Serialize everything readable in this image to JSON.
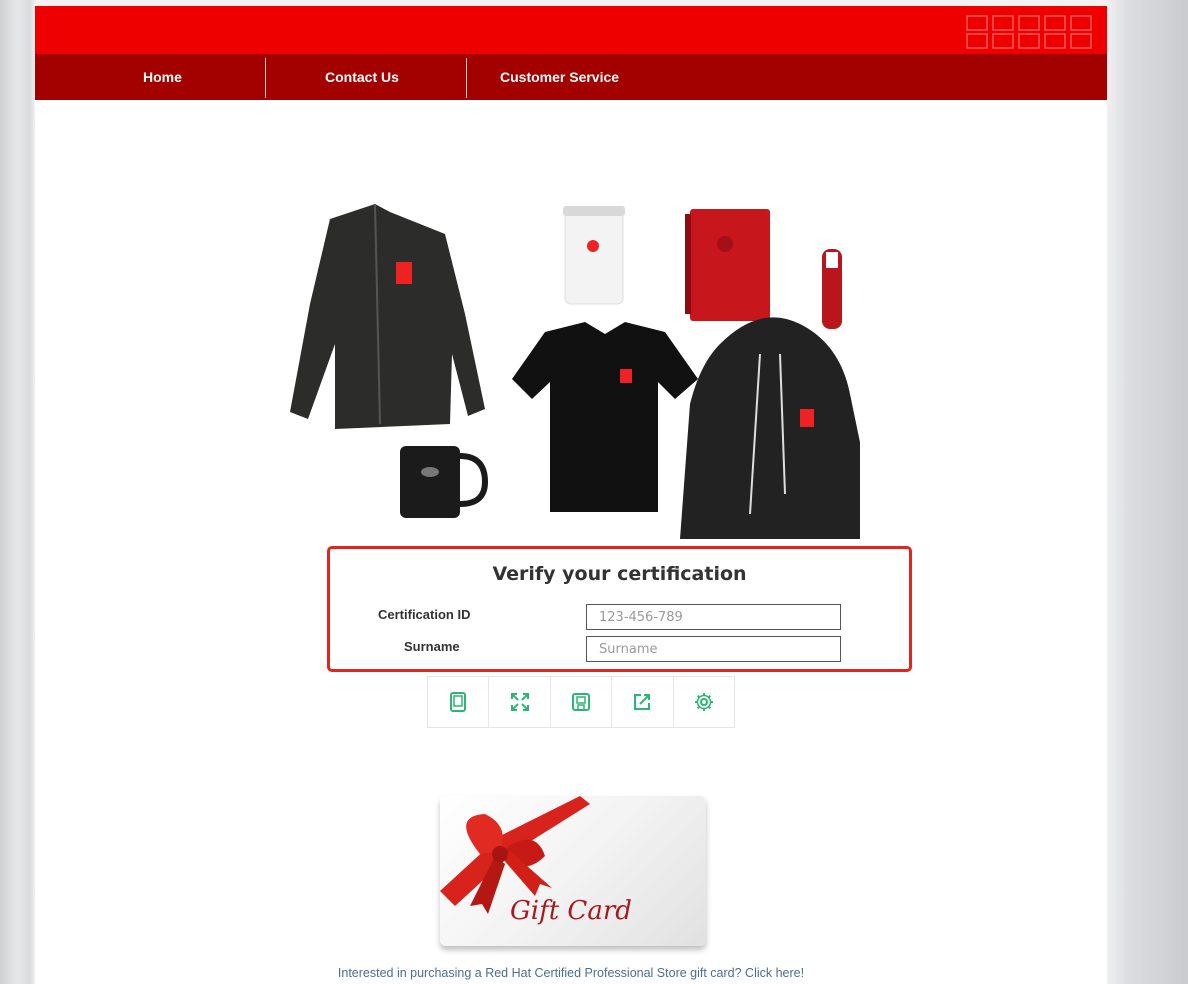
{
  "nav": {
    "items": [
      {
        "label": "Home"
      },
      {
        "label": "Contact Us"
      },
      {
        "label": "Customer Service"
      }
    ]
  },
  "verify": {
    "title": "Verify your certification",
    "cert_label": "Certification ID",
    "cert_placeholder": "123-456-789",
    "surname_label": "Surname",
    "surname_placeholder": "Surname"
  },
  "toolbar": {
    "icons": [
      "tablet-icon",
      "expand-icon",
      "save-icon",
      "share-icon",
      "settings-gear-icon"
    ]
  },
  "giftcard": {
    "text": "Gift Card",
    "link_text": "Interested in purchasing a Red Hat Certified Professional Store gift card? Click here!"
  },
  "colors": {
    "topbar": "#ee0000",
    "navbar": "#a30000",
    "verify_border": "#e2241b",
    "toolbar_icon": "#2bb673",
    "link": "#4a6f92"
  }
}
